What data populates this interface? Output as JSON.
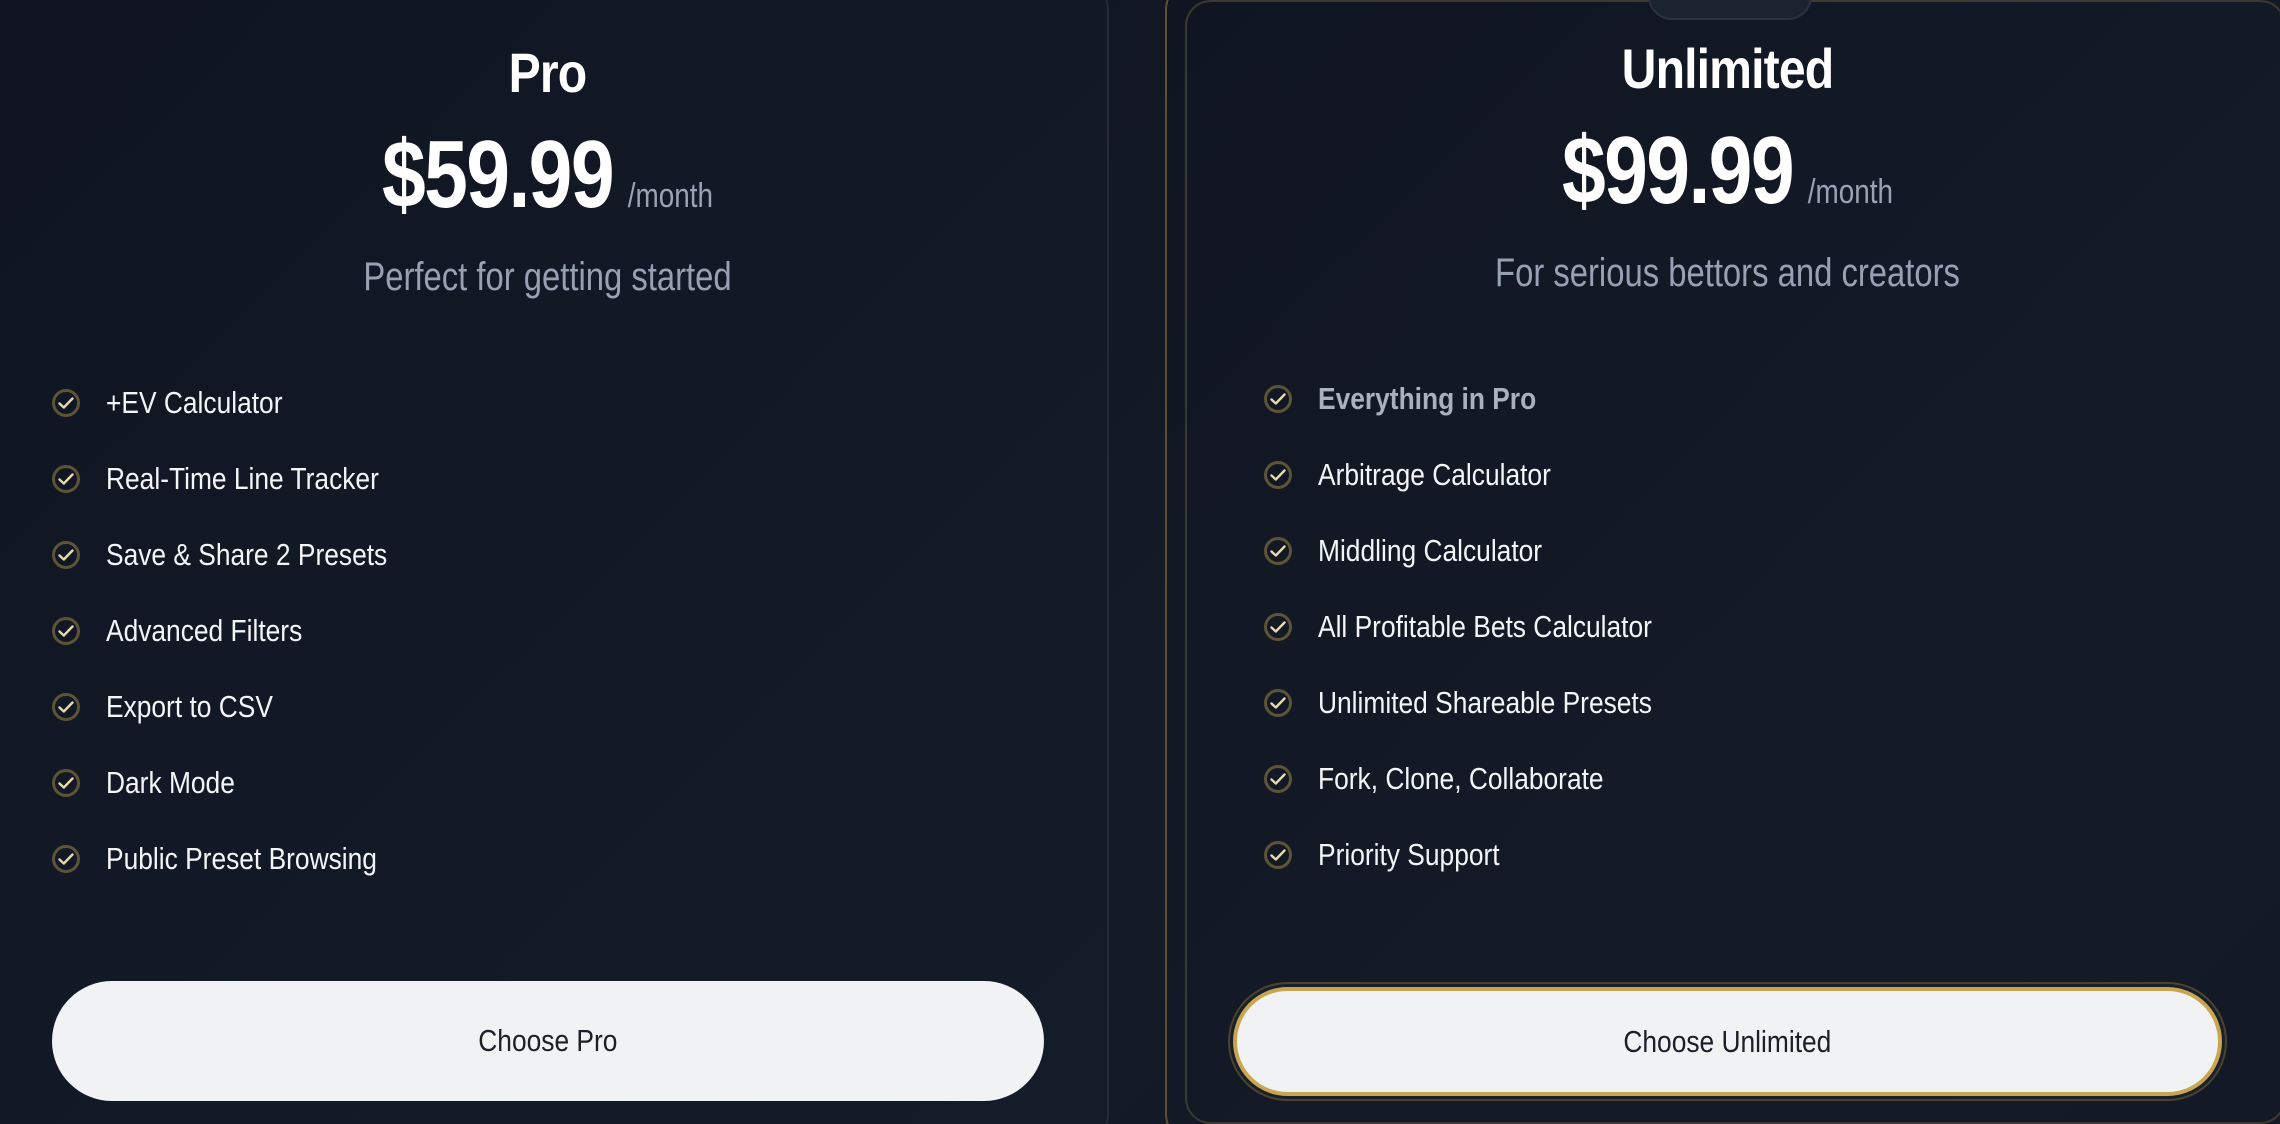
{
  "plans": [
    {
      "name": "Pro",
      "price": "$59.99",
      "period": "/month",
      "tagline": "Perfect for getting started",
      "features": [
        {
          "label": "+EV Calculator",
          "emphasis": false
        },
        {
          "label": "Real-Time Line Tracker",
          "emphasis": false
        },
        {
          "label": "Save & Share 2 Presets",
          "emphasis": false
        },
        {
          "label": "Advanced Filters",
          "emphasis": false
        },
        {
          "label": "Export to CSV",
          "emphasis": false
        },
        {
          "label": "Dark Mode",
          "emphasis": false
        },
        {
          "label": "Public Preset Browsing",
          "emphasis": false
        }
      ],
      "cta_label": "Choose Pro"
    },
    {
      "name": "Unlimited",
      "price": "$99.99",
      "period": "/month",
      "tagline": "For serious bettors and creators",
      "features": [
        {
          "label": "Everything in Pro",
          "emphasis": true
        },
        {
          "label": "Arbitrage Calculator",
          "emphasis": false
        },
        {
          "label": "Middling Calculator",
          "emphasis": false
        },
        {
          "label": "All Profitable Bets Calculator",
          "emphasis": false
        },
        {
          "label": "Unlimited Shareable Presets",
          "emphasis": false
        },
        {
          "label": "Fork, Clone, Collaborate",
          "emphasis": false
        },
        {
          "label": "Priority Support",
          "emphasis": false
        }
      ],
      "cta_label": "Choose Unlimited"
    }
  ],
  "colors": {
    "background": "#0f1420",
    "accent_gold": "#c8a650",
    "check_ring": "#5d5437",
    "check_mark": "#e8d9a8",
    "text_primary": "#ffffff",
    "text_muted": "#98a1b3",
    "button_bg": "#f1f2f4"
  },
  "icons": {
    "feature_check": "check-circle-icon"
  }
}
